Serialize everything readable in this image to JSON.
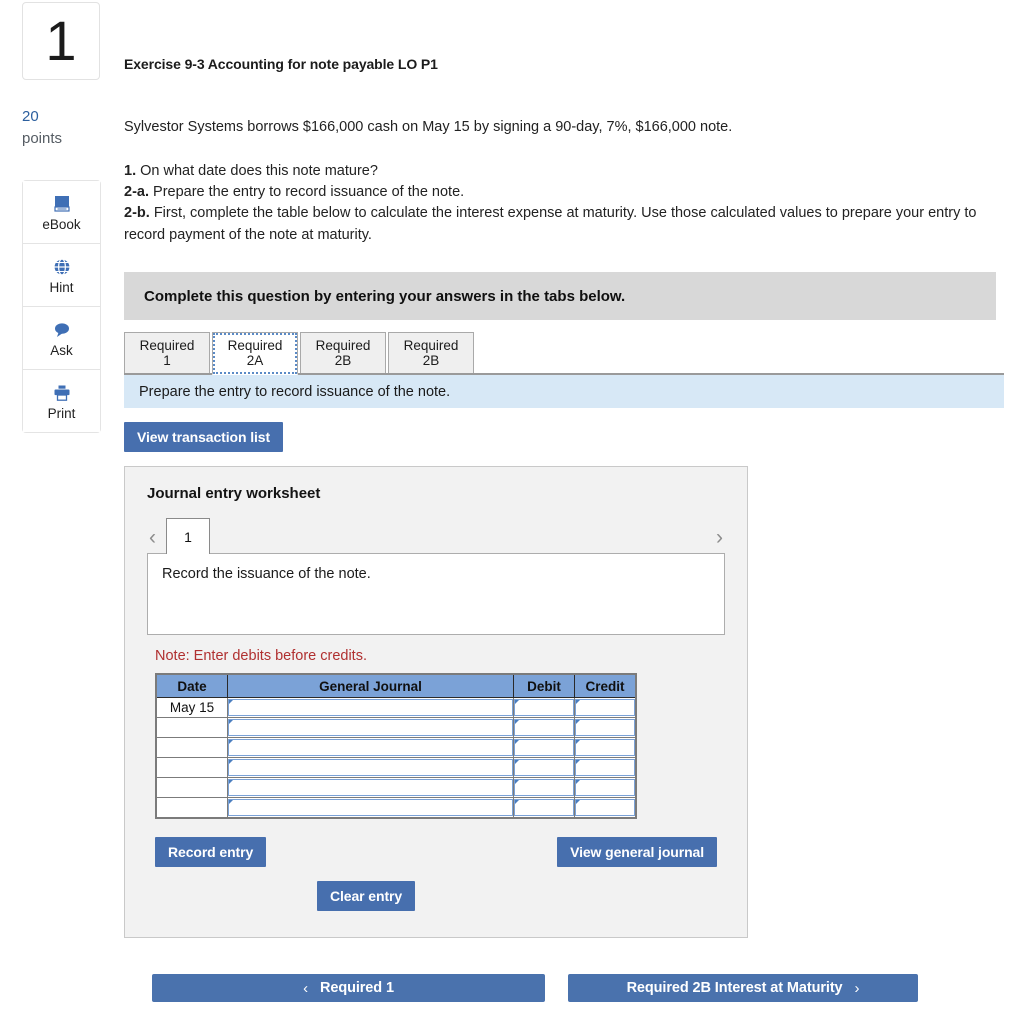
{
  "question": {
    "number": "1",
    "points_value": "20",
    "points_label": "points"
  },
  "tools": [
    {
      "label": "eBook",
      "icon": "book-icon"
    },
    {
      "label": "Hint",
      "icon": "globe-icon"
    },
    {
      "label": "Ask",
      "icon": "speech-bubble-icon"
    },
    {
      "label": "Print",
      "icon": "printer-icon"
    }
  ],
  "exercise": {
    "title": "Exercise 9-3 Accounting for note payable LO P1",
    "scenario": "Sylvestor Systems borrows $166,000 cash on May 15 by signing a 90-day, 7%, $166,000 note.",
    "requirements": [
      {
        "num": "1.",
        "text": "On what date does this note mature?"
      },
      {
        "num": "2-a.",
        "text": "Prepare the entry to record issuance of the note."
      },
      {
        "num": "2-b.",
        "text": "First, complete the table below to calculate the interest expense at maturity. Use those calculated values to prepare your entry to record payment of the note at maturity."
      }
    ]
  },
  "banner": {
    "instruction": "Complete this question by entering your answers in the tabs below."
  },
  "tabs": [
    {
      "line1": "Required",
      "line2": "1",
      "active": false
    },
    {
      "line1": "Required",
      "line2": "2A",
      "active": true
    },
    {
      "line1": "Required",
      "line2": "2B",
      "active": false
    },
    {
      "line1": "Required",
      "line2": "2B",
      "active": false
    }
  ],
  "tab_prompt": "Prepare the entry to record issuance of the note.",
  "toolbar": {
    "view_transaction_list": "View transaction list"
  },
  "worksheet": {
    "title": "Journal entry worksheet",
    "page_number": "1",
    "prev_arrow": "‹",
    "next_arrow": "›",
    "description": "Record the issuance of the note.",
    "note": "Note: Enter debits before credits.",
    "columns": [
      "Date",
      "General Journal",
      "Debit",
      "Credit"
    ],
    "rows": [
      {
        "date": "May 15",
        "general_journal": "",
        "debit": "",
        "credit": ""
      },
      {
        "date": "",
        "general_journal": "",
        "debit": "",
        "credit": ""
      },
      {
        "date": "",
        "general_journal": "",
        "debit": "",
        "credit": ""
      },
      {
        "date": "",
        "general_journal": "",
        "debit": "",
        "credit": ""
      },
      {
        "date": "",
        "general_journal": "",
        "debit": "",
        "credit": ""
      },
      {
        "date": "",
        "general_journal": "",
        "debit": "",
        "credit": ""
      }
    ],
    "buttons": {
      "record_entry": "Record entry",
      "view_general_journal": "View general journal",
      "clear_entry": "Clear entry"
    }
  },
  "bottom_nav": {
    "prev_label": "Required 1",
    "prev_chevron": "‹",
    "next_label": "Required 2B Interest at Maturity",
    "next_chevron": "›"
  },
  "colors": {
    "accent_blue": "#476fae",
    "nav_blue": "#4a72ad",
    "table_header_blue": "#7ba2d7",
    "tab_prompt_blue": "#d7e8f6",
    "gray_banner": "#d8d8d8",
    "note_red": "#b03030",
    "points_blue": "#2c5f9e"
  }
}
